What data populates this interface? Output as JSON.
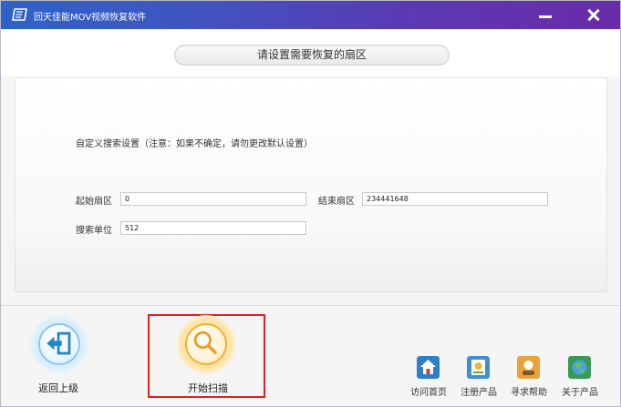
{
  "window": {
    "title": "回天佳能MOV视频恢复软件"
  },
  "heading": "请设置需要恢复的扇区",
  "form": {
    "hint": "自定义搜索设置（注意：如果不确定，请勿更改默认设置）",
    "start_sector": {
      "label": "起始扇区",
      "value": "0"
    },
    "end_sector": {
      "label": "结束扇区",
      "value": "234441648"
    },
    "search_unit": {
      "label": "搜索单位",
      "value": "512"
    }
  },
  "actions": {
    "back_label": "返回上级",
    "scan_label": "开始扫描"
  },
  "footer": {
    "links": [
      {
        "label": "访问首页",
        "icon": "home-icon"
      },
      {
        "label": "注册产品",
        "icon": "register-icon"
      },
      {
        "label": "寻求帮助",
        "icon": "help-icon"
      },
      {
        "label": "关于产品",
        "icon": "globe-icon"
      }
    ]
  },
  "colors": {
    "titlebar_start": "#2e63c7",
    "titlebar_end": "#6a2ba8",
    "highlight_frame": "#e02020",
    "scan_accent": "#f0b23c",
    "back_accent": "#8ec7ea"
  }
}
